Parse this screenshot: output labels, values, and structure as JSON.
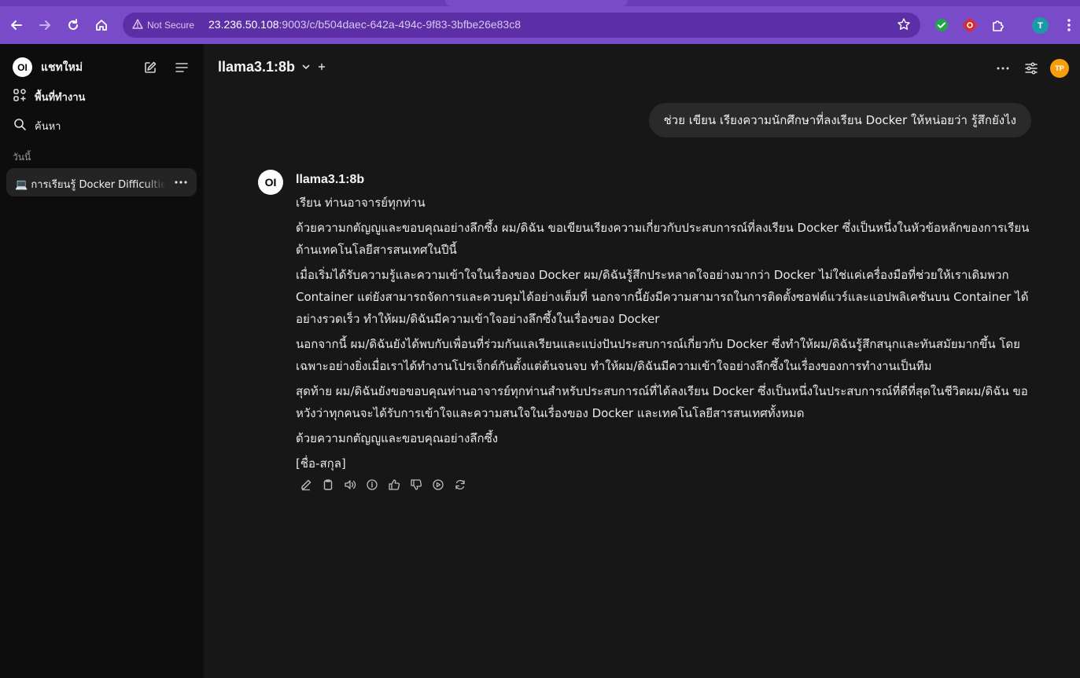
{
  "browser": {
    "not_secure_label": "Not Secure",
    "url_host": "23.236.50.108",
    "url_rest": ":9003/c/b504daec-642a-494c-9f83-3bfbe26e83c8",
    "profile_initial": "T",
    "accent": "#7a4bc9"
  },
  "sidebar": {
    "logo_text": "OI",
    "new_chat_label": "แชทใหม่",
    "workspace_label": "พื้นที่ทำงาน",
    "search_label": "ค้นหา",
    "section_today": "วันนี้",
    "chats": [
      {
        "title": "💻 การเรียนรู้ Docker Difficulties"
      }
    ]
  },
  "header": {
    "model_name": "llama3.1:8b",
    "user_initials": "TP",
    "avatar_color": "#f59e0b"
  },
  "conversation": {
    "user_message": "ช่วย เขียน เรียงความนักศึกษาที่ลงเรียน Docker ให้หน่อยว่า รู้สึกยังไง",
    "assistant": {
      "avatar_text": "OI",
      "name": "llama3.1:8b",
      "paragraphs": [
        "เรียน ท่านอาจารย์ทุกท่าน",
        "ด้วยความกตัญญูและขอบคุณอย่างลึกซึ้ง ผม/ดิฉัน ขอเขียนเรียงความเกี่ยวกับประสบการณ์ที่ลงเรียน Docker ซึ่งเป็นหนึ่งในหัวข้อหลักของการเรียนด้านเทคโนโลยีสารสนเทศในปีนี้",
        "เมื่อเริ่มได้รับความรู้และความเข้าใจในเรื่องของ Docker ผม/ดิฉันรู้สึกประหลาดใจอย่างมากว่า Docker ไม่ใช่แค่เครื่องมือที่ช่วยให้เราเดิมพวก Container แต่ยังสามารถจัดการและควบคุมได้อย่างเต็มที่ นอกจากนี้ยังมีความสามารถในการติดตั้งซอฟต์แวร์และแอปพลิเคชันบน Container ได้อย่างรวดเร็ว ทำให้ผม/ดิฉันมีความเข้าใจอย่างลึกซึ้งในเรื่องของ Docker",
        "นอกจากนี้ ผม/ดิฉันยังได้พบกับเพื่อนที่ร่วมกันแลเรียนและแบ่งปันประสบการณ์เกี่ยวกับ Docker ซึ่งทำให้ผม/ดิฉันรู้สึกสนุกและทันสมัยมากขึ้น โดยเฉพาะอย่างยิ่งเมื่อเราได้ทำงานโปรเจ็กต์กันตั้งแต่ต้นจนจบ ทำให้ผม/ดิฉันมีความเข้าใจอย่างลึกซึ้งในเรื่องของการทำงานเป็นทีม",
        "สุดท้าย ผม/ดิฉันยังขอขอบคุณท่านอาจารย์ทุกท่านสำหรับประสบการณ์ที่ได้ลงเรียน Docker ซึ่งเป็นหนึ่งในประสบการณ์ที่ดีที่สุดในชีวิตผม/ดิฉัน ขอหวังว่าทุกคนจะได้รับการเข้าใจและความสนใจในเรื่องของ Docker และเทคโนโลยีสารสนเทศทั้งหมด",
        "ด้วยความกตัญญูและขอบคุณอย่างลึกซึ้ง",
        "[ชื่อ-สกุล]"
      ]
    },
    "action_icons": [
      "edit-icon",
      "copy-icon",
      "speaker-icon",
      "info-icon",
      "thumbs-up-icon",
      "thumbs-down-icon",
      "continue-icon",
      "regenerate-icon"
    ]
  }
}
